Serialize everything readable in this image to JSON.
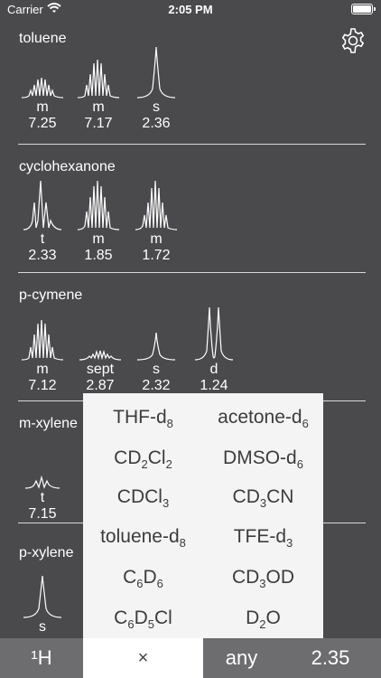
{
  "status_bar": {
    "carrier": "Carrier",
    "time": "2:05 PM"
  },
  "compounds": [
    {
      "name": "toluene",
      "peaks": [
        {
          "multiplicity": "m",
          "shift": "7.25"
        },
        {
          "multiplicity": "m",
          "shift": "7.17"
        },
        {
          "multiplicity": "s",
          "shift": "2.36"
        }
      ]
    },
    {
      "name": "cyclohexanone",
      "peaks": [
        {
          "multiplicity": "t",
          "shift": "2.33"
        },
        {
          "multiplicity": "m",
          "shift": "1.85"
        },
        {
          "multiplicity": "m",
          "shift": "1.72"
        }
      ]
    },
    {
      "name": "p-cymene",
      "peaks": [
        {
          "multiplicity": "m",
          "shift": "7.12"
        },
        {
          "multiplicity": "sept",
          "shift": "2.87"
        },
        {
          "multiplicity": "s",
          "shift": "2.32"
        },
        {
          "multiplicity": "d",
          "shift": "1.24"
        }
      ]
    },
    {
      "name": "m-xylene",
      "peaks": [
        {
          "multiplicity": "t",
          "shift": "7.15"
        }
      ]
    },
    {
      "name": "p-xylene",
      "peaks": [
        {
          "multiplicity": "s",
          "shift": ""
        }
      ]
    }
  ],
  "solvents": [
    {
      "base": "THF-d",
      "sub": "8",
      "rest": ""
    },
    {
      "base": "acetone-d",
      "sub": "6",
      "rest": ""
    },
    {
      "base": "CD",
      "sub": "2",
      "rest": "Cl",
      "sub2": "2"
    },
    {
      "base": "DMSO-d",
      "sub": "6",
      "rest": ""
    },
    {
      "base": "CDCl",
      "sub": "3",
      "rest": ""
    },
    {
      "base": "CD",
      "sub": "3",
      "rest": "CN"
    },
    {
      "base": "toluene-d",
      "sub": "8",
      "rest": ""
    },
    {
      "base": "TFE-d",
      "sub": "3",
      "rest": ""
    },
    {
      "base": "C",
      "sub": "6",
      "rest": "D",
      "sub2": "6"
    },
    {
      "base": "CD",
      "sub": "3",
      "rest": "OD"
    },
    {
      "base": "C",
      "sub": "6",
      "rest": "D",
      "sub2": "5",
      "rest2": "Cl"
    },
    {
      "base": "D",
      "sub": "2",
      "rest": "O"
    }
  ],
  "bottom_bar": {
    "nucleus": "¹H",
    "close": "×",
    "filter": "any",
    "value": "2.35"
  }
}
